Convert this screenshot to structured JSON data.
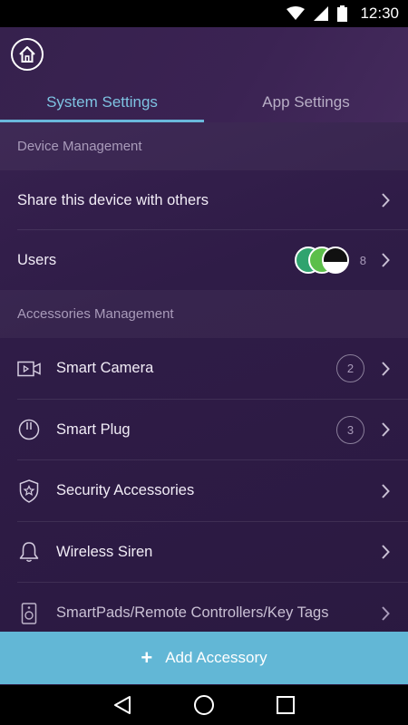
{
  "status_bar": {
    "time": "12:30"
  },
  "tabs": [
    {
      "label": "System Settings",
      "active": true
    },
    {
      "label": "App Settings",
      "active": false
    }
  ],
  "sections": {
    "device_management": {
      "title": "Device Management",
      "share_label": "Share this device with others",
      "users_label": "Users",
      "users_count": "8"
    },
    "accessories_management": {
      "title": "Accessories Management",
      "items": [
        {
          "label": "Smart Camera",
          "icon": "video-camera-icon",
          "count": "2"
        },
        {
          "label": "Smart Plug",
          "icon": "power-icon",
          "count": "3"
        },
        {
          "label": "Security Accessories",
          "icon": "shield-star-icon"
        },
        {
          "label": "Wireless Siren",
          "icon": "bell-icon"
        },
        {
          "label": "SmartPads/Remote Controllers/Key Tags",
          "icon": "speaker-device-icon"
        }
      ]
    }
  },
  "add_button": {
    "label": "Add Accessory"
  },
  "colors": {
    "accent": "#62b7d6",
    "active_tab": "#7ec3e2",
    "background": "#2f1c47"
  }
}
